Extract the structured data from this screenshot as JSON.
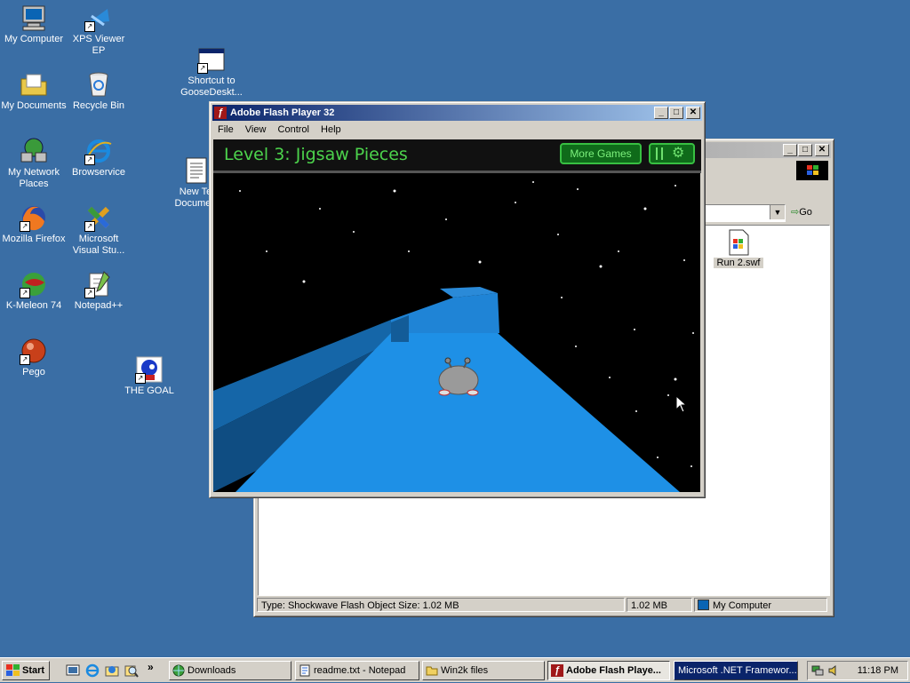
{
  "desktop": {
    "icons": [
      {
        "label": "My Computer",
        "icon": "my-computer-icon"
      },
      {
        "label": "XPS Viewer EP",
        "icon": "xps-viewer-icon"
      },
      {
        "label": "My Documents",
        "icon": "my-documents-icon"
      },
      {
        "label": "Recycle Bin",
        "icon": "recycle-bin-icon"
      },
      {
        "label": "My Network Places",
        "icon": "network-places-icon"
      },
      {
        "label": "Browservice",
        "icon": "browservice-icon"
      },
      {
        "label": "Mozilla Firefox",
        "icon": "firefox-icon"
      },
      {
        "label": "Microsoft Visual Stu...",
        "icon": "visual-studio-icon"
      },
      {
        "label": "K-Meleon 74",
        "icon": "k-meleon-icon"
      },
      {
        "label": "Notepad++",
        "icon": "notepad-plus-plus-icon"
      },
      {
        "label": "Pego",
        "icon": "pego-icon"
      },
      {
        "label": "THE GOAL",
        "icon": "sonic-icon"
      },
      {
        "label": "Shortcut to GooseDeskt...",
        "icon": "window-shortcut-icon"
      },
      {
        "label": "New Te Documen",
        "icon": "text-document-icon"
      }
    ]
  },
  "flash_window": {
    "title": "Adobe Flash Player 32",
    "menu": [
      "File",
      "View",
      "Control",
      "Help"
    ],
    "level_title": "Level 3: Jigsaw Pieces",
    "more_games": "More Games"
  },
  "explorer_window": {
    "go_label": "Go",
    "file_name": "Run 2.swf",
    "status_type": "Type: Shockwave Flash Object Size: 1.02 MB",
    "status_size": "1.02 MB",
    "status_zone": "My Computer"
  },
  "taskbar": {
    "start_label": "Start",
    "tasks": [
      {
        "label": "Downloads",
        "icon": "globe-icon"
      },
      {
        "label": "readme.txt - Notepad",
        "icon": "notepad-icon"
      },
      {
        "label": "Win2k files",
        "icon": "folder-icon"
      },
      {
        "label": "Adobe Flash Playe...",
        "icon": "flash-icon"
      },
      {
        "label": "Microsoft .NET Framewor...",
        "icon": "dotnet-icon"
      }
    ],
    "clock": "11:18 PM"
  },
  "colors": {
    "desktop": "#3a6ea5",
    "title_active": "#0a246a",
    "flash_green": "#4cd34c",
    "tunnel_blue": "#1e90ff"
  }
}
